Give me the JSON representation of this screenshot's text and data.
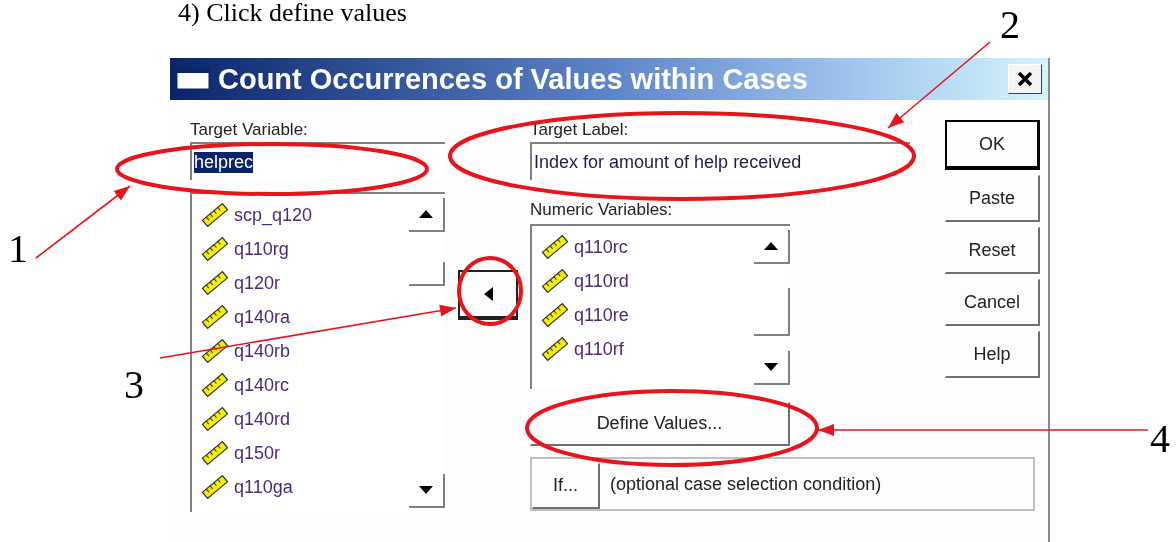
{
  "instruction": "4) Click define values",
  "dialog": {
    "title": "Count Occurrences of Values within Cases",
    "target_variable": {
      "label": "Target Variable:",
      "value": "helprec",
      "selected": true
    },
    "target_label": {
      "label": "Target Label:",
      "value": "Index for amount of help received"
    },
    "source_list": {
      "items": [
        "scp_q120",
        "q110rg",
        "q120r",
        "q140ra",
        "q140rb",
        "q140rc",
        "q140rd",
        "q150r",
        "q110ga"
      ]
    },
    "numeric_variables": {
      "label": "Numeric Variables:",
      "items": [
        "q110rc",
        "q110rd",
        "q110re",
        "q110rf"
      ]
    },
    "define_values_button": "Define Values...",
    "if_button": "If...",
    "if_condition": "(optional case selection condition)",
    "buttons": [
      {
        "label": "OK",
        "default": true
      },
      {
        "label": "Paste",
        "default": false
      },
      {
        "label": "Reset",
        "default": false
      },
      {
        "label": "Cancel",
        "default": false
      },
      {
        "label": "Help",
        "default": false
      }
    ]
  },
  "annotations": [
    {
      "number": "1"
    },
    {
      "number": "2"
    },
    {
      "number": "3"
    },
    {
      "number": "4"
    }
  ]
}
